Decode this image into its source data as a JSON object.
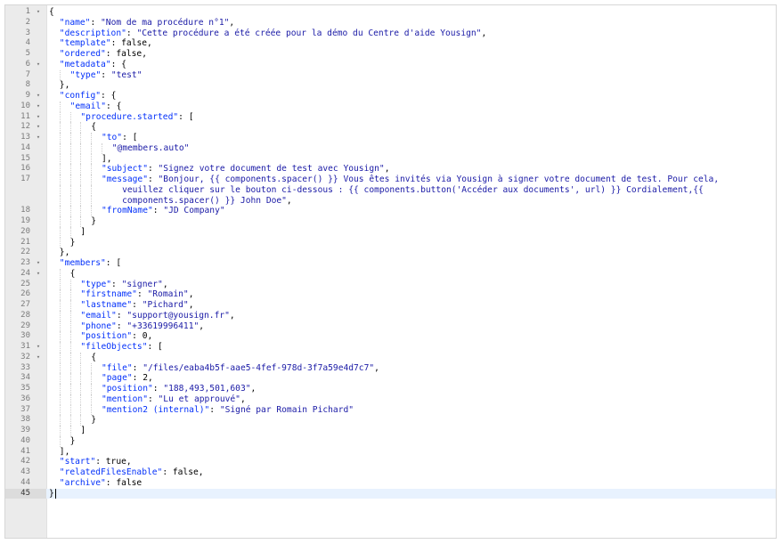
{
  "editor": {
    "lines": [
      {
        "n": "1",
        "fold": true,
        "indent": 0,
        "parts": [
          {
            "t": "{"
          }
        ]
      },
      {
        "n": "2",
        "indent": 1,
        "parts": [
          {
            "t": "\"name\"",
            "c": "k"
          },
          {
            "t": ": "
          },
          {
            "t": "\"Nom de ma procédure n°1\"",
            "c": "s"
          },
          {
            "t": ","
          }
        ]
      },
      {
        "n": "3",
        "indent": 1,
        "parts": [
          {
            "t": "\"description\"",
            "c": "k"
          },
          {
            "t": ": "
          },
          {
            "t": "\"Cette procédure a été créée pour la démo du Centre d'aide Yousign\"",
            "c": "s"
          },
          {
            "t": ","
          }
        ]
      },
      {
        "n": "4",
        "indent": 1,
        "parts": [
          {
            "t": "\"template\"",
            "c": "k"
          },
          {
            "t": ": false,"
          }
        ]
      },
      {
        "n": "5",
        "indent": 1,
        "parts": [
          {
            "t": "\"ordered\"",
            "c": "k"
          },
          {
            "t": ": false,"
          }
        ]
      },
      {
        "n": "6",
        "fold": true,
        "indent": 1,
        "parts": [
          {
            "t": "\"metadata\"",
            "c": "k"
          },
          {
            "t": ": {"
          }
        ]
      },
      {
        "n": "7",
        "indent": 2,
        "parts": [
          {
            "t": "\"type\"",
            "c": "k"
          },
          {
            "t": ": "
          },
          {
            "t": "\"test\"",
            "c": "s"
          }
        ]
      },
      {
        "n": "8",
        "indent": 1,
        "parts": [
          {
            "t": "},"
          }
        ]
      },
      {
        "n": "9",
        "fold": true,
        "indent": 1,
        "parts": [
          {
            "t": "\"config\"",
            "c": "k"
          },
          {
            "t": ": {"
          }
        ]
      },
      {
        "n": "10",
        "fold": true,
        "indent": 2,
        "parts": [
          {
            "t": "\"email\"",
            "c": "k"
          },
          {
            "t": ": {"
          }
        ]
      },
      {
        "n": "11",
        "fold": true,
        "indent": 3,
        "parts": [
          {
            "t": "\"procedure.started\"",
            "c": "k"
          },
          {
            "t": ": ["
          }
        ]
      },
      {
        "n": "12",
        "fold": true,
        "indent": 4,
        "parts": [
          {
            "t": "{"
          }
        ]
      },
      {
        "n": "13",
        "fold": true,
        "indent": 5,
        "parts": [
          {
            "t": "\"to\"",
            "c": "k"
          },
          {
            "t": ": ["
          }
        ]
      },
      {
        "n": "14",
        "indent": 6,
        "parts": [
          {
            "t": "\"@members.auto\"",
            "c": "s"
          }
        ]
      },
      {
        "n": "15",
        "indent": 5,
        "parts": [
          {
            "t": "],"
          }
        ]
      },
      {
        "n": "16",
        "indent": 5,
        "parts": [
          {
            "t": "\"subject\"",
            "c": "k"
          },
          {
            "t": ": "
          },
          {
            "t": "\"Signez votre document de test avec Yousign\"",
            "c": "s"
          },
          {
            "t": ","
          }
        ]
      },
      {
        "n": "17",
        "indent": 5,
        "parts": [
          {
            "t": "\"message\"",
            "c": "k"
          },
          {
            "t": ": "
          },
          {
            "t": "\"Bonjour, {{ components.spacer() }} Vous êtes invités via Yousign à signer votre document de test. Pour cela,",
            "c": "s"
          }
        ]
      },
      {
        "n": "",
        "indent": 5,
        "parts": [
          {
            "t": "    veuillez cliquer sur le bouton ci-dessous : {{ components.button('Accéder aux documents', url) }} Cordialement,{{",
            "c": "s"
          }
        ]
      },
      {
        "n": "",
        "indent": 5,
        "parts": [
          {
            "t": "    components.spacer() }} John Doe\"",
            "c": "s"
          },
          {
            "t": ","
          }
        ]
      },
      {
        "n": "18",
        "indent": 5,
        "parts": [
          {
            "t": "\"fromName\"",
            "c": "k"
          },
          {
            "t": ": "
          },
          {
            "t": "\"JD Company\"",
            "c": "s"
          }
        ]
      },
      {
        "n": "19",
        "indent": 4,
        "parts": [
          {
            "t": "}"
          }
        ]
      },
      {
        "n": "20",
        "indent": 3,
        "parts": [
          {
            "t": "]"
          }
        ]
      },
      {
        "n": "21",
        "indent": 2,
        "parts": [
          {
            "t": "}"
          }
        ]
      },
      {
        "n": "22",
        "indent": 1,
        "parts": [
          {
            "t": "},"
          }
        ]
      },
      {
        "n": "23",
        "fold": true,
        "indent": 1,
        "parts": [
          {
            "t": "\"members\"",
            "c": "k"
          },
          {
            "t": ": ["
          }
        ]
      },
      {
        "n": "24",
        "fold": true,
        "indent": 2,
        "parts": [
          {
            "t": "{"
          }
        ]
      },
      {
        "n": "25",
        "indent": 3,
        "parts": [
          {
            "t": "\"type\"",
            "c": "k"
          },
          {
            "t": ": "
          },
          {
            "t": "\"signer\"",
            "c": "s"
          },
          {
            "t": ","
          }
        ]
      },
      {
        "n": "26",
        "indent": 3,
        "parts": [
          {
            "t": "\"firstname\"",
            "c": "k"
          },
          {
            "t": ": "
          },
          {
            "t": "\"Romain\"",
            "c": "s"
          },
          {
            "t": ","
          }
        ]
      },
      {
        "n": "27",
        "indent": 3,
        "parts": [
          {
            "t": "\"lastname\"",
            "c": "k"
          },
          {
            "t": ": "
          },
          {
            "t": "\"Pichard\"",
            "c": "s"
          },
          {
            "t": ","
          }
        ]
      },
      {
        "n": "28",
        "indent": 3,
        "parts": [
          {
            "t": "\"email\"",
            "c": "k"
          },
          {
            "t": ": "
          },
          {
            "t": "\"support@yousign.fr\"",
            "c": "s"
          },
          {
            "t": ","
          }
        ]
      },
      {
        "n": "29",
        "indent": 3,
        "parts": [
          {
            "t": "\"phone\"",
            "c": "k"
          },
          {
            "t": ": "
          },
          {
            "t": "\"+33619996411\"",
            "c": "s"
          },
          {
            "t": ","
          }
        ]
      },
      {
        "n": "30",
        "indent": 3,
        "parts": [
          {
            "t": "\"position\"",
            "c": "k"
          },
          {
            "t": ": 0,"
          }
        ]
      },
      {
        "n": "31",
        "fold": true,
        "indent": 3,
        "parts": [
          {
            "t": "\"fileObjects\"",
            "c": "k"
          },
          {
            "t": ": ["
          }
        ]
      },
      {
        "n": "32",
        "fold": true,
        "indent": 4,
        "parts": [
          {
            "t": "{"
          }
        ]
      },
      {
        "n": "33",
        "indent": 5,
        "parts": [
          {
            "t": "\"file\"",
            "c": "k"
          },
          {
            "t": ": "
          },
          {
            "t": "\"/files/eaba4b5f-aae5-4fef-978d-3f7a59e4d7c7\"",
            "c": "s"
          },
          {
            "t": ","
          }
        ]
      },
      {
        "n": "34",
        "indent": 5,
        "parts": [
          {
            "t": "\"page\"",
            "c": "k"
          },
          {
            "t": ": 2,"
          }
        ]
      },
      {
        "n": "35",
        "indent": 5,
        "parts": [
          {
            "t": "\"position\"",
            "c": "k"
          },
          {
            "t": ": "
          },
          {
            "t": "\"188,493,501,603\"",
            "c": "s"
          },
          {
            "t": ","
          }
        ]
      },
      {
        "n": "36",
        "indent": 5,
        "parts": [
          {
            "t": "\"mention\"",
            "c": "k"
          },
          {
            "t": ": "
          },
          {
            "t": "\"Lu et approuvé\"",
            "c": "s"
          },
          {
            "t": ","
          }
        ]
      },
      {
        "n": "37",
        "indent": 5,
        "parts": [
          {
            "t": "\"mention2 (internal)\"",
            "c": "k"
          },
          {
            "t": ": "
          },
          {
            "t": "\"Signé par Romain Pichard\"",
            "c": "s"
          }
        ]
      },
      {
        "n": "38",
        "indent": 4,
        "parts": [
          {
            "t": "}"
          }
        ]
      },
      {
        "n": "39",
        "indent": 3,
        "parts": [
          {
            "t": "]"
          }
        ]
      },
      {
        "n": "40",
        "indent": 2,
        "parts": [
          {
            "t": "}"
          }
        ]
      },
      {
        "n": "41",
        "indent": 1,
        "parts": [
          {
            "t": "],"
          }
        ]
      },
      {
        "n": "42",
        "indent": 1,
        "parts": [
          {
            "t": "\"start\"",
            "c": "k"
          },
          {
            "t": ": true,"
          }
        ]
      },
      {
        "n": "43",
        "indent": 1,
        "parts": [
          {
            "t": "\"relatedFilesEnable\"",
            "c": "k"
          },
          {
            "t": ": false,"
          }
        ]
      },
      {
        "n": "44",
        "indent": 1,
        "parts": [
          {
            "t": "\"archive\"",
            "c": "k"
          },
          {
            "t": ": false"
          }
        ]
      },
      {
        "n": "45",
        "indent": 0,
        "active": true,
        "cursor": true,
        "parts": [
          {
            "t": "}"
          }
        ]
      }
    ],
    "fold_icon": "chevron-down-icon",
    "colors": {
      "key": "#0431fa",
      "string": "#1a1aa6",
      "active_line": "#e8f2fe",
      "gutter": "#ebebeb"
    }
  }
}
